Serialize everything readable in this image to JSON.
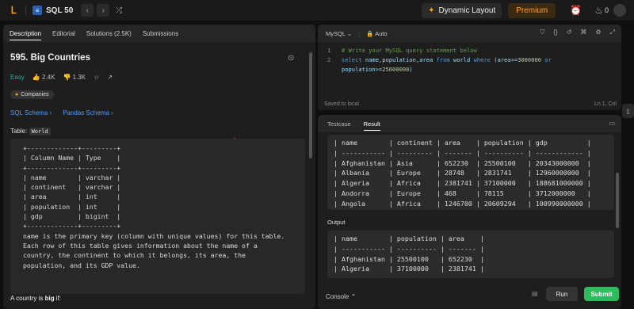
{
  "topbar": {
    "problem_list_label": "SQL 50",
    "dynamic_layout_label": "Dynamic Layout",
    "premium_label": "Premium",
    "streak_count": "0"
  },
  "left_panel": {
    "tabs": [
      "Description",
      "Editorial",
      "Solutions (2.5K)",
      "Submissions"
    ],
    "title": "595. Big Countries",
    "difficulty": "Easy",
    "likes": "2.4K",
    "dislikes": "1.3K",
    "companies_label": "Companies",
    "sql_schema_label": "SQL Schema",
    "pandas_schema_label": "Pandas Schema",
    "table_prefix": "Table:",
    "table_name": "World",
    "schema_text": "+-------------+---------+\n| Column Name | Type    |\n+-------------+---------+\n| name        | varchar |\n| continent   | varchar |\n| area        | int     |\n| population  | int     |\n| gdp         | bigint  |\n+-------------+---------+\nname is the primary key (column with unique values) for this table.\nEach row of this table gives information about the name of a\ncountry, the continent to which it belongs, its area, the\npopulation, and its GDP value.",
    "bottom_text_prefix": "A country is ",
    "bottom_text_bold": "big",
    "bottom_text_suffix": " if:"
  },
  "editor": {
    "language": "MySQL",
    "mode": "Auto",
    "line1": "# Write your MySQL query statement below",
    "line2_parts": {
      "select": "select",
      "cols": " name,population,area ",
      "from": "from",
      "table": " world ",
      "where": "where",
      "cond1": " (area>=",
      "val1": "3000000",
      "or": " or",
      "cond2": "population>=",
      "val2": "25000000",
      "close": ")"
    },
    "saved_label": "Saved to local",
    "cursor_position": "Ln 1, Col"
  },
  "results": {
    "tabs": [
      "Testcase",
      "Result"
    ],
    "input_table": "| name        | continent | area    | population | gdp          |\n| ----------- | --------- | ------- | ---------- | ------------ |\n| Afghanistan | Asia      | 652230  | 25500100   | 20343000000  |\n| Albania     | Europe    | 28748   | 2831741    | 12960000000  |\n| Algeria     | Africa    | 2381741 | 37100000   | 188681000000 |\n| Andorra     | Europe    | 468     | 78115      | 3712000000   |\n| Angola      | Africa    | 1246700 | 20609294   | 100990000000 |",
    "output_label": "Output",
    "output_table": "| name        | population | area    |\n| ----------- | ---------- | ------- |\n| Afghanistan | 25500100   | 652230  |\n| Algeria     | 37100000   | 2381741 |",
    "console_label": "Console",
    "run_label": "Run",
    "submit_label": "Submit"
  }
}
